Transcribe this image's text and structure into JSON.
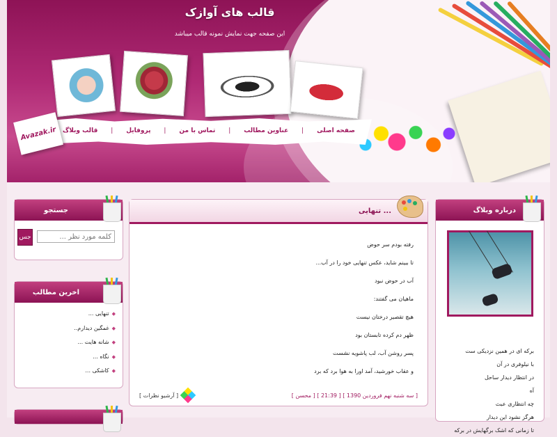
{
  "header": {
    "site_title": "قالب های آوازک",
    "site_description": "این صفحه جهت نمایش نمونه قالب میباشد",
    "badge_text": "Avazak.ir"
  },
  "nav": {
    "items": [
      {
        "label": "صفحه اصلی"
      },
      {
        "label": "عناوین مطالب"
      },
      {
        "label": "تماس با من"
      },
      {
        "label": "پروفایل"
      },
      {
        "label": "قالب وبلاگ"
      }
    ],
    "separator": "|"
  },
  "about": {
    "title": "درباره وبلاگ",
    "lines": [
      "برکه ای در همین نزدیکی ست",
      "با نیلوفری در آن",
      "در انتظار دیدار ساحل",
      "آه",
      "چه انتظاری عبث",
      "هرگز نشود این دیدار",
      "تا زمانی که اشک برگهایش در برکه"
    ]
  },
  "post": {
    "title": "تنهایی ...",
    "lines": [
      "رفته بودم سر حوض",
      "تا ببینم شاید، عکس تنهایی خود را در آب...",
      "آب در حوض نبود",
      "ماهیان می گفتند:",
      "هیچ تقصیر درختان نیست",
      "ظهر دم کرده تابستان بود",
      "پسر روشن آب، لب پاشویه نشست",
      "و عقاب خورشید، آمد اورا به هوا برد که برد"
    ],
    "meta": "[ سه شنبه نهم فروردین 1390 ] [ 21:39 ] [ محسن ]",
    "archive_label": "[ آرشیو نظرات ]"
  },
  "search": {
    "title": "جستجو",
    "placeholder": "کلمه مورد نظر ...",
    "button_label": "جس"
  },
  "recent": {
    "title": "اخرین مطالب",
    "items": [
      "تنهایی ...",
      "غمگین دیدارم..",
      "شانه هایت ...",
      "نگاه ...",
      "کاشکی ..."
    ]
  },
  "colors": {
    "brand": "#a0195f",
    "header_dark": "#8e1356",
    "panel_head_top": "#c2407f",
    "panel_head_bottom": "#8c1354",
    "page_bg": "#f3e4ec"
  }
}
